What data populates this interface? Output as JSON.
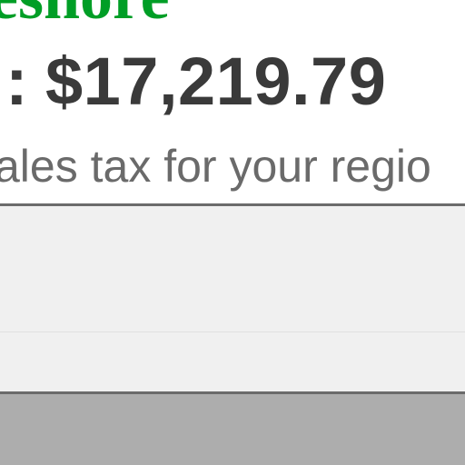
{
  "header": {
    "title_fragment": "eshore"
  },
  "summary": {
    "total_prefix": ":",
    "total_amount": "$17,219.79",
    "tax_note": "ales tax for your regio"
  },
  "colors": {
    "title": "#009e26",
    "total": "#3a3a3a",
    "tax_note": "#6a6a6a",
    "panel_background": "#f0f0f0",
    "panel_border": "#6b6b6b",
    "footer": "#adadad"
  }
}
